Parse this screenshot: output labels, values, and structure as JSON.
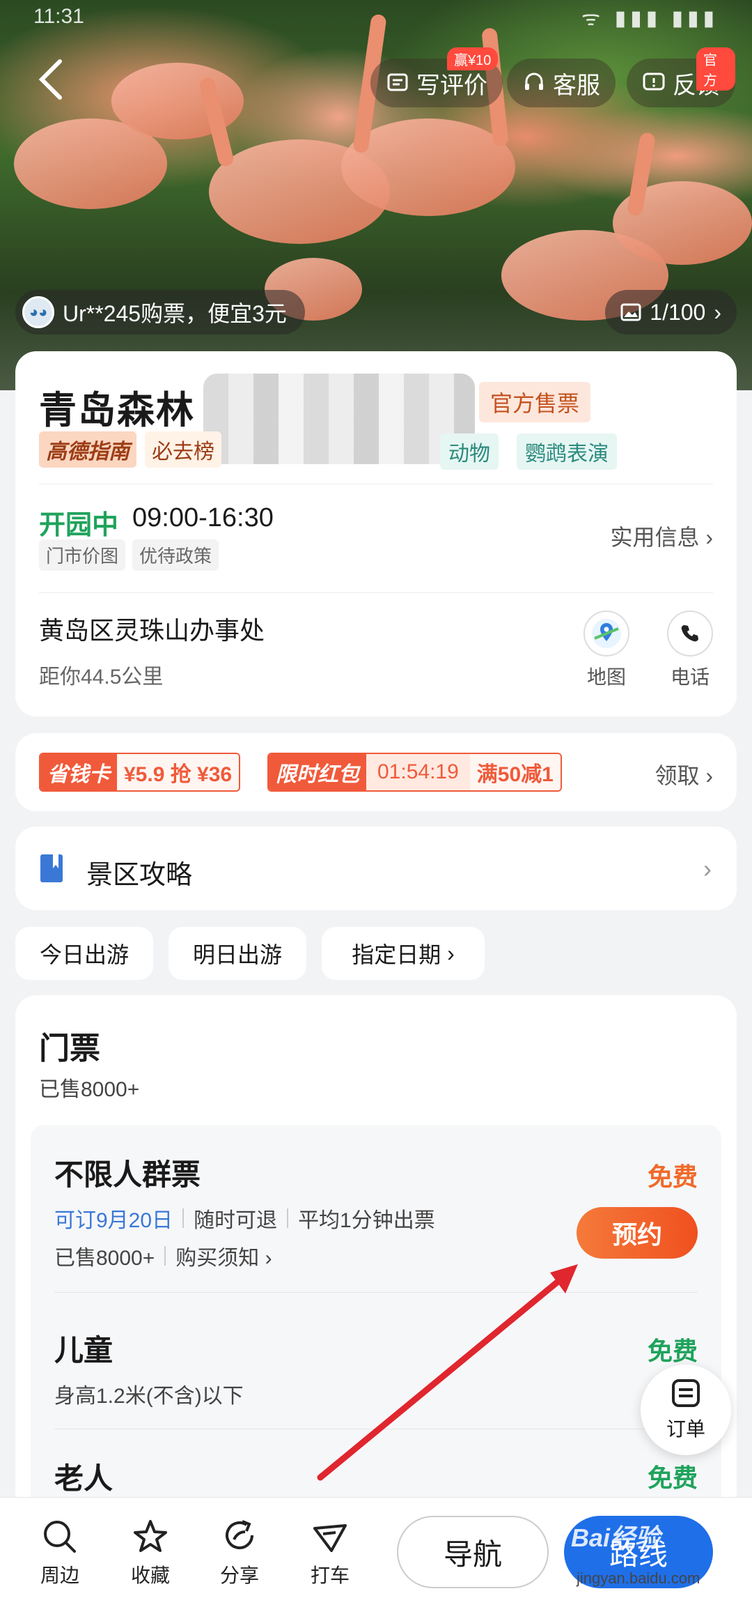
{
  "status_bar": {
    "time": "11:31",
    "right_icons": "ᯤ ▮▮▮ ▮▮▮"
  },
  "header": {
    "review": {
      "label": "写评价",
      "badge": "赢¥10"
    },
    "service": {
      "label": "客服"
    },
    "feedback": {
      "label": "反馈",
      "badge": "官方"
    }
  },
  "hero": {
    "buyer_tip": "Ur**245购票，便宜3元",
    "photo_count": "1/100"
  },
  "poi": {
    "title": "青岛森林",
    "official_tag": "官方售票",
    "gaode_tag": "高德指南",
    "must_go_tag": "必去榜",
    "tag_animals": "动物",
    "tag_parrot_show": "鹦鹉表演",
    "open_status": "开园中",
    "hours": "09:00-16:30",
    "mini_tags": [
      "门市价图",
      "优待政策"
    ],
    "practical_info": "实用信息",
    "address": "黄岛区灵珠山办事处",
    "distance": "距你44.5公里",
    "map_label": "地图",
    "phone_label": "电话"
  },
  "promos": {
    "card_label": "省钱卡",
    "card_value": "¥5.9 抢 ¥36",
    "redpacket_label": "限时红包",
    "timer": "01:54:19",
    "discount": "满50减1",
    "claim": "领取"
  },
  "guide": {
    "label": "景区攻略"
  },
  "dates": [
    "今日出游",
    "明日出游",
    "指定日期"
  ],
  "tickets": {
    "title": "门票",
    "sold": "已售8000+",
    "items": [
      {
        "name": "不限人群票",
        "bookable": "可订9月20日",
        "refund": "随时可退",
        "issue": "平均1分钟出票",
        "sold": "已售8000+",
        "notice": "购买须知",
        "price": "免费",
        "button": "预约"
      },
      {
        "name": "儿童",
        "desc": "身高1.2米(不含)以下",
        "price": "免费"
      },
      {
        "name": "老人",
        "price": "免费"
      }
    ]
  },
  "float_order": {
    "label": "订单"
  },
  "bottom_bar": {
    "tabs": [
      "周边",
      "收藏",
      "分享",
      "打车"
    ],
    "navigate": "导航",
    "route": "路线"
  },
  "watermark": {
    "brand": "Bai经验",
    "url": "jingyan.baidu.com"
  },
  "colors": {
    "accent_orange": "#f06a2a",
    "green": "#1fa35b",
    "blue": "#1f6fe8",
    "red_arrow": "#e0262e"
  }
}
